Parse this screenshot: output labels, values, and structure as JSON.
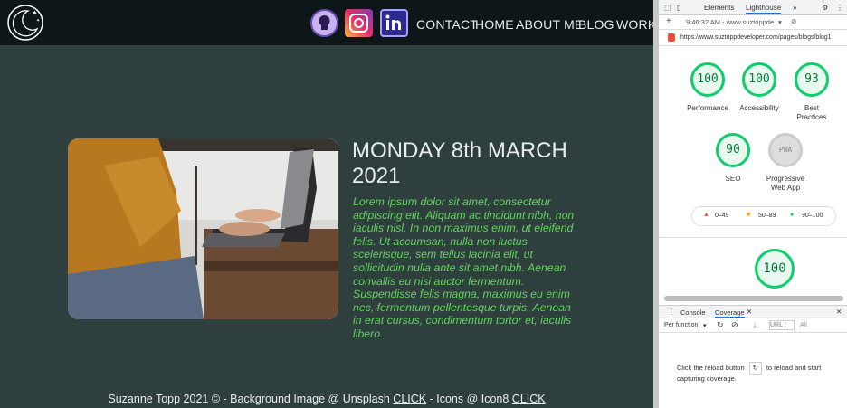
{
  "site": {
    "nav": [
      "CONTACT",
      "HOME",
      "ABOUT ME",
      "BLOG",
      "WORK"
    ],
    "post": {
      "title": "MONDAY 8th MARCH 2021",
      "body": "Lorem ipsum dolor sit amet, consectetur adipiscing elit. Aliquam ac tincidunt nibh, non iaculis nisl. In non maximus enim, ut eleifend felis. Ut accumsan, nulla non luctus scelerisque, sem tellus lacinia elit, ut sollicitudin nulla ante sit amet nibh. Aenean convallis eu nisi auctor fermentum. Suspendisse felis magna, maximus eu enim nec, fermentum pellentesque turpis. Aenean in erat cursus, condimentum tortor et, iaculis libero."
    },
    "footer": {
      "text1": "Suzanne Topp 2021 © - Background Image @ Unsplash ",
      "link1": "CLICK",
      "text2": " - Icons @ Icon8 ",
      "link2": "CLICK"
    }
  },
  "devtools": {
    "tabs": [
      "Elements",
      "Lighthouse"
    ],
    "more": "»",
    "report_time": "9:46:32 AM - www.suztoppde",
    "url": "https://www.suztoppdeveloper.com/pages/blogs/blog1",
    "scores": [
      {
        "label": "Performance",
        "value": "100"
      },
      {
        "label": "Accessibility",
        "value": "100"
      },
      {
        "label": "Best Practices",
        "value": "93"
      },
      {
        "label": "SEO",
        "value": "90"
      },
      {
        "label": "Progressive Web App",
        "value": "PWA"
      }
    ],
    "legend": [
      "0–49",
      "50–89",
      "90–100"
    ],
    "big_score": "100",
    "bottom_tabs": [
      "Console",
      "Coverage"
    ],
    "per_function": "Per function",
    "url_filter_placeholder": "URL f",
    "filter_all": "All",
    "coverage_msg_1": "Click the reload button",
    "coverage_msg_2": "to reload and start capturing coverage."
  },
  "colors": {
    "pass": "#0cce6b",
    "average": "#ffa400",
    "fail": "#ff4e42",
    "body_green": "#62d35e"
  }
}
